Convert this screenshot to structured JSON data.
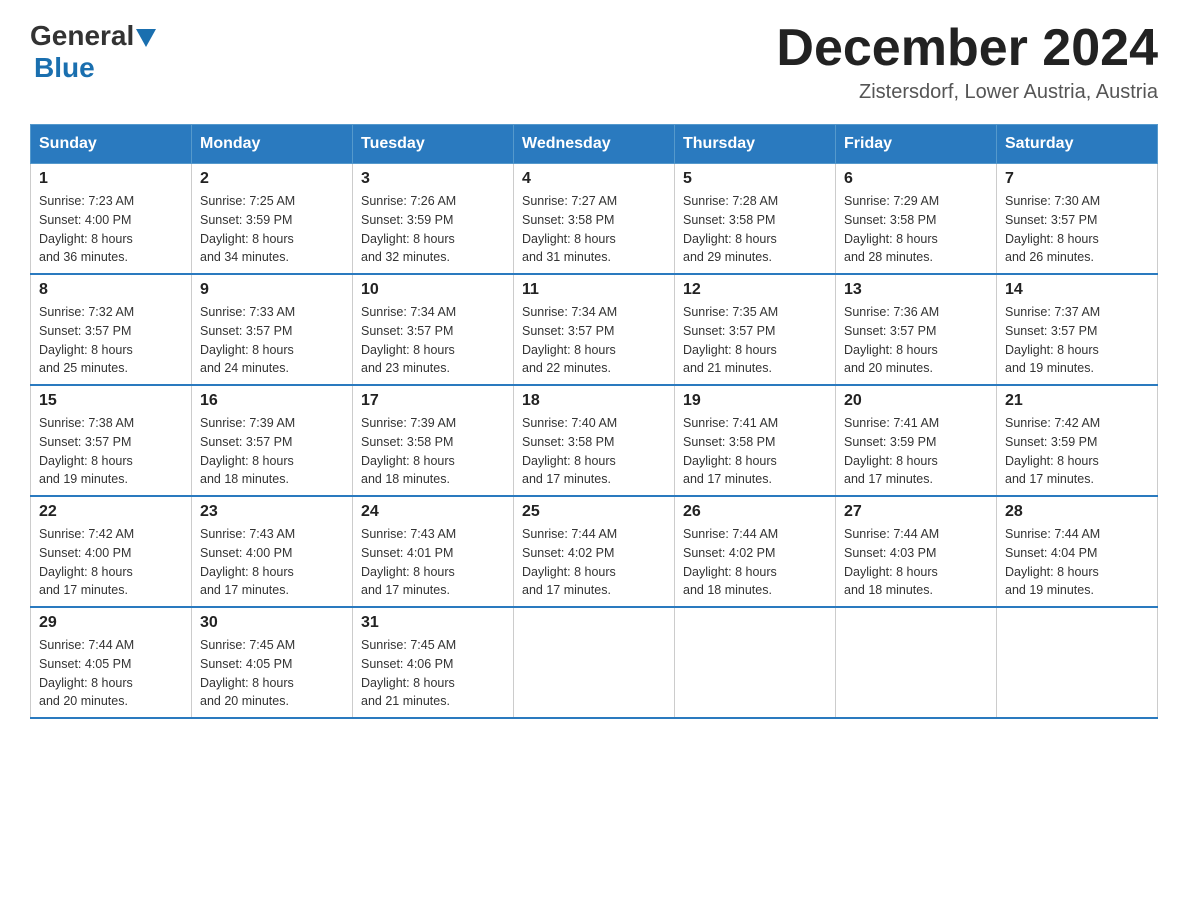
{
  "header": {
    "title": "December 2024",
    "subtitle": "Zistersdorf, Lower Austria, Austria",
    "logo_general": "General",
    "logo_blue": "Blue"
  },
  "days_of_week": [
    "Sunday",
    "Monday",
    "Tuesday",
    "Wednesday",
    "Thursday",
    "Friday",
    "Saturday"
  ],
  "weeks": [
    [
      {
        "day": "1",
        "sunrise": "7:23 AM",
        "sunset": "4:00 PM",
        "daylight_hours": "8 hours",
        "daylight_minutes": "and 36 minutes."
      },
      {
        "day": "2",
        "sunrise": "7:25 AM",
        "sunset": "3:59 PM",
        "daylight_hours": "8 hours",
        "daylight_minutes": "and 34 minutes."
      },
      {
        "day": "3",
        "sunrise": "7:26 AM",
        "sunset": "3:59 PM",
        "daylight_hours": "8 hours",
        "daylight_minutes": "and 32 minutes."
      },
      {
        "day": "4",
        "sunrise": "7:27 AM",
        "sunset": "3:58 PM",
        "daylight_hours": "8 hours",
        "daylight_minutes": "and 31 minutes."
      },
      {
        "day": "5",
        "sunrise": "7:28 AM",
        "sunset": "3:58 PM",
        "daylight_hours": "8 hours",
        "daylight_minutes": "and 29 minutes."
      },
      {
        "day": "6",
        "sunrise": "7:29 AM",
        "sunset": "3:58 PM",
        "daylight_hours": "8 hours",
        "daylight_minutes": "and 28 minutes."
      },
      {
        "day": "7",
        "sunrise": "7:30 AM",
        "sunset": "3:57 PM",
        "daylight_hours": "8 hours",
        "daylight_minutes": "and 26 minutes."
      }
    ],
    [
      {
        "day": "8",
        "sunrise": "7:32 AM",
        "sunset": "3:57 PM",
        "daylight_hours": "8 hours",
        "daylight_minutes": "and 25 minutes."
      },
      {
        "day": "9",
        "sunrise": "7:33 AM",
        "sunset": "3:57 PM",
        "daylight_hours": "8 hours",
        "daylight_minutes": "and 24 minutes."
      },
      {
        "day": "10",
        "sunrise": "7:34 AM",
        "sunset": "3:57 PM",
        "daylight_hours": "8 hours",
        "daylight_minutes": "and 23 minutes."
      },
      {
        "day": "11",
        "sunrise": "7:34 AM",
        "sunset": "3:57 PM",
        "daylight_hours": "8 hours",
        "daylight_minutes": "and 22 minutes."
      },
      {
        "day": "12",
        "sunrise": "7:35 AM",
        "sunset": "3:57 PM",
        "daylight_hours": "8 hours",
        "daylight_minutes": "and 21 minutes."
      },
      {
        "day": "13",
        "sunrise": "7:36 AM",
        "sunset": "3:57 PM",
        "daylight_hours": "8 hours",
        "daylight_minutes": "and 20 minutes."
      },
      {
        "day": "14",
        "sunrise": "7:37 AM",
        "sunset": "3:57 PM",
        "daylight_hours": "8 hours",
        "daylight_minutes": "and 19 minutes."
      }
    ],
    [
      {
        "day": "15",
        "sunrise": "7:38 AM",
        "sunset": "3:57 PM",
        "daylight_hours": "8 hours",
        "daylight_minutes": "and 19 minutes."
      },
      {
        "day": "16",
        "sunrise": "7:39 AM",
        "sunset": "3:57 PM",
        "daylight_hours": "8 hours",
        "daylight_minutes": "and 18 minutes."
      },
      {
        "day": "17",
        "sunrise": "7:39 AM",
        "sunset": "3:58 PM",
        "daylight_hours": "8 hours",
        "daylight_minutes": "and 18 minutes."
      },
      {
        "day": "18",
        "sunrise": "7:40 AM",
        "sunset": "3:58 PM",
        "daylight_hours": "8 hours",
        "daylight_minutes": "and 17 minutes."
      },
      {
        "day": "19",
        "sunrise": "7:41 AM",
        "sunset": "3:58 PM",
        "daylight_hours": "8 hours",
        "daylight_minutes": "and 17 minutes."
      },
      {
        "day": "20",
        "sunrise": "7:41 AM",
        "sunset": "3:59 PM",
        "daylight_hours": "8 hours",
        "daylight_minutes": "and 17 minutes."
      },
      {
        "day": "21",
        "sunrise": "7:42 AM",
        "sunset": "3:59 PM",
        "daylight_hours": "8 hours",
        "daylight_minutes": "and 17 minutes."
      }
    ],
    [
      {
        "day": "22",
        "sunrise": "7:42 AM",
        "sunset": "4:00 PM",
        "daylight_hours": "8 hours",
        "daylight_minutes": "and 17 minutes."
      },
      {
        "day": "23",
        "sunrise": "7:43 AM",
        "sunset": "4:00 PM",
        "daylight_hours": "8 hours",
        "daylight_minutes": "and 17 minutes."
      },
      {
        "day": "24",
        "sunrise": "7:43 AM",
        "sunset": "4:01 PM",
        "daylight_hours": "8 hours",
        "daylight_minutes": "and 17 minutes."
      },
      {
        "day": "25",
        "sunrise": "7:44 AM",
        "sunset": "4:02 PM",
        "daylight_hours": "8 hours",
        "daylight_minutes": "and 17 minutes."
      },
      {
        "day": "26",
        "sunrise": "7:44 AM",
        "sunset": "4:02 PM",
        "daylight_hours": "8 hours",
        "daylight_minutes": "and 18 minutes."
      },
      {
        "day": "27",
        "sunrise": "7:44 AM",
        "sunset": "4:03 PM",
        "daylight_hours": "8 hours",
        "daylight_minutes": "and 18 minutes."
      },
      {
        "day": "28",
        "sunrise": "7:44 AM",
        "sunset": "4:04 PM",
        "daylight_hours": "8 hours",
        "daylight_minutes": "and 19 minutes."
      }
    ],
    [
      {
        "day": "29",
        "sunrise": "7:44 AM",
        "sunset": "4:05 PM",
        "daylight_hours": "8 hours",
        "daylight_minutes": "and 20 minutes."
      },
      {
        "day": "30",
        "sunrise": "7:45 AM",
        "sunset": "4:05 PM",
        "daylight_hours": "8 hours",
        "daylight_minutes": "and 20 minutes."
      },
      {
        "day": "31",
        "sunrise": "7:45 AM",
        "sunset": "4:06 PM",
        "daylight_hours": "8 hours",
        "daylight_minutes": "and 21 minutes."
      },
      null,
      null,
      null,
      null
    ]
  ]
}
